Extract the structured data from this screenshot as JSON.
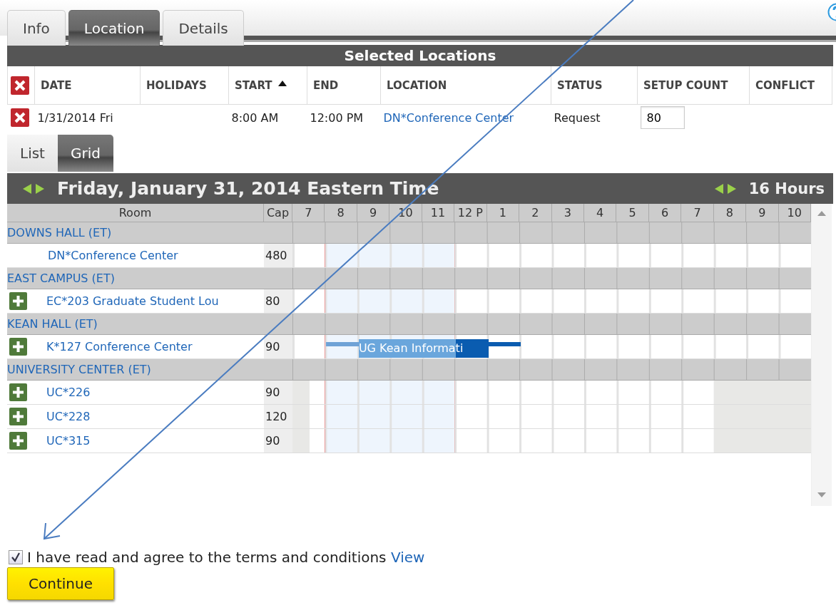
{
  "tabs": [
    {
      "label": "Info",
      "selected": false
    },
    {
      "label": "Location",
      "selected": true
    },
    {
      "label": "Details",
      "selected": false
    }
  ],
  "selected_locations": {
    "title": "Selected Locations",
    "columns": [
      {
        "label": "DATE",
        "sorted": false
      },
      {
        "label": "HOLIDAYS",
        "sorted": false
      },
      {
        "label": "START",
        "sorted": true
      },
      {
        "label": "END",
        "sorted": false
      },
      {
        "label": "LOCATION",
        "sorted": false
      },
      {
        "label": "STATUS",
        "sorted": false
      },
      {
        "label": "SETUP COUNT",
        "sorted": false
      },
      {
        "label": "CONFLICT",
        "sorted": false
      }
    ],
    "rows": [
      {
        "date": "1/31/2014 Fri",
        "start": "8:00 AM",
        "end": "12:00 PM",
        "location": "DN*Conference Center",
        "status": "Request",
        "setup_count": "80"
      }
    ]
  },
  "view_tabs": [
    {
      "label": "List",
      "selected": false
    },
    {
      "label": "Grid",
      "selected": true
    }
  ],
  "grid": {
    "title": "Friday, January 31, 2014 Eastern Time",
    "range": "16 Hours",
    "room_header": "Room",
    "cap_header": "Cap",
    "hours": [
      {
        "label": "7",
        "selected": false
      },
      {
        "label": "8",
        "selected": true
      },
      {
        "label": "9",
        "selected": true
      },
      {
        "label": "10",
        "selected": true
      },
      {
        "label": "11",
        "selected": true
      },
      {
        "label": "12 P",
        "selected": false
      },
      {
        "label": "1",
        "selected": false
      },
      {
        "label": "2",
        "selected": false
      },
      {
        "label": "3",
        "selected": false
      },
      {
        "label": "4",
        "selected": false
      },
      {
        "label": "5",
        "selected": false
      },
      {
        "label": "6",
        "selected": false
      },
      {
        "label": "7",
        "selected": false
      },
      {
        "label": "8",
        "selected": false
      },
      {
        "label": "9",
        "selected": false
      },
      {
        "label": "10",
        "selected": false
      }
    ],
    "groups": [
      {
        "name": "DOWNS HALL (ET)",
        "rooms": [
          {
            "name": "DN*Conference Center",
            "cap": "480",
            "addable": false,
            "closed": false
          }
        ]
      },
      {
        "name": "EAST CAMPUS (ET)",
        "rooms": [
          {
            "name": "EC*203 Graduate Student Lou",
            "cap": "80",
            "addable": true,
            "closed": false
          }
        ]
      },
      {
        "name": "KEAN HALL (ET)",
        "rooms": [
          {
            "name": "K*127 Conference Center",
            "cap": "90",
            "addable": true,
            "closed": false,
            "booking": {
              "label": "UG Kean Informati",
              "segments": [
                {
                  "kind": "setup"
                },
                {
                  "kind": "event"
                },
                {
                  "kind": "conflict"
                },
                {
                  "kind": "teardown"
                }
              ]
            }
          }
        ]
      },
      {
        "name": "UNIVERSITY CENTER (ET)",
        "rooms": [
          {
            "name": "UC*226",
            "cap": "90",
            "addable": true,
            "closed": true
          },
          {
            "name": "UC*228",
            "cap": "120",
            "addable": true,
            "closed": true
          },
          {
            "name": "UC*315",
            "cap": "90",
            "addable": true,
            "closed": true
          }
        ]
      }
    ]
  },
  "terms": {
    "checked": true,
    "text": "I have read and agree to the terms and conditions",
    "link": "View"
  },
  "continue_button": "Continue"
}
